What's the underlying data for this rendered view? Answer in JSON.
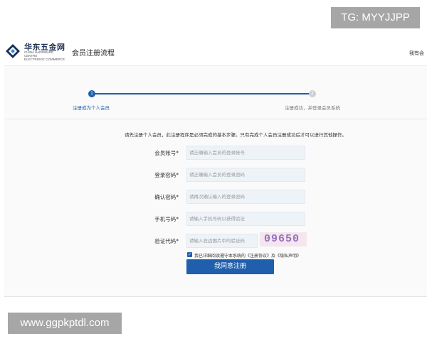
{
  "watermarks": {
    "top": "TG: MYYJJPP",
    "bottom": "www.ggpkptdl.com"
  },
  "header": {
    "logo_title": "华东五金网",
    "logo_sub_line1": "CHINA HARDWARE CENTRE",
    "logo_sub_line2": "ELECTRONIC COMMERCE",
    "page_title": "会员注册流程",
    "have_account": "我有会"
  },
  "progress": {
    "steps": [
      {
        "number": "1",
        "label": "注册成为个人会员",
        "active": true
      },
      {
        "number": "2",
        "label": "注册成功，并登录会员系统",
        "active": false
      }
    ]
  },
  "notice": "请先注册个人会员，此注册程序是必须完成的基本步骤。只有完成个人会员注册成功后才可以进行其他操作。",
  "form": {
    "fields": [
      {
        "label": "会员账号*",
        "placeholder": "请正确输入会员的登录帐号"
      },
      {
        "label": "登录密码*",
        "placeholder": "请正确输入会员的登录密码"
      },
      {
        "label": "确认密码*",
        "placeholder": "请再次确认输入的登录密码"
      },
      {
        "label": "手机号码*",
        "placeholder": "请输入手机号码以获得验证"
      },
      {
        "label": "验证代码*",
        "placeholder": "请输入右边图片中的验证码"
      }
    ],
    "captcha_text": "09650",
    "agree_text": "我已详细阅读遵守本系统的《注册协议》及《隐私声明》",
    "submit_label": "我同意注册"
  },
  "colors": {
    "accent": "#1f5fac",
    "inactive_step": "#d0d0d0",
    "input_bg": "#eef3f8"
  }
}
